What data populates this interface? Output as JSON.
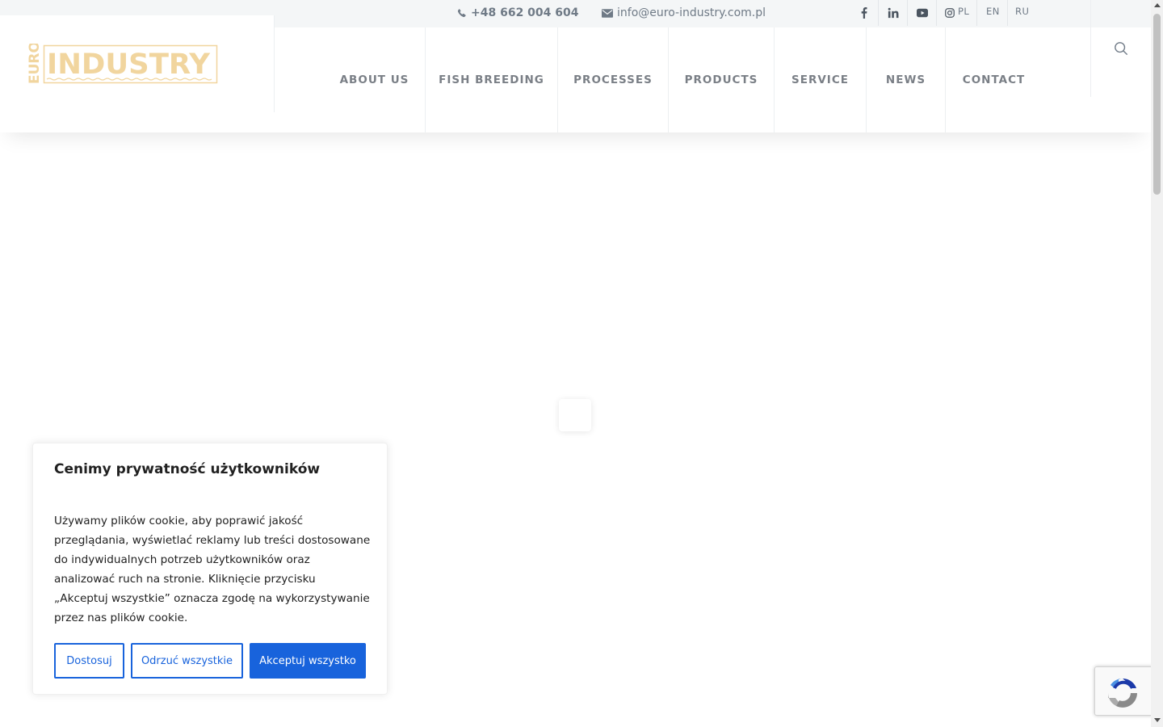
{
  "topbar": {
    "phone": "+48 662 004 604",
    "email": "info@euro-industry.com.pl",
    "social": [
      "facebook-icon",
      "linkedin-icon",
      "youtube-icon",
      "instagram-icon"
    ],
    "languages": [
      "PL",
      "EN",
      "RU"
    ]
  },
  "logo": {
    "euro": "EURO",
    "industry": "INDUSTRY",
    "color": "#f1d59e"
  },
  "nav": {
    "items": [
      "ABOUT US",
      "FISH BREEDING",
      "PROCESSES",
      "PRODUCTS",
      "SERVICE",
      "NEWS",
      "CONTACT"
    ]
  },
  "cookie": {
    "title": "Cenimy prywatność użytkowników",
    "body": "Używamy plików cookie, aby poprawić jakość przeglądania, wyświetlać reklamy lub treści dostosowane do indywidualnych potrzeb użytkowników oraz analizować ruch na stronie. Kliknięcie przycisku „Akceptuj wszystkie” oznacza zgodę na wykorzystywanie przez nas plików cookie.",
    "customize_label": "Dostosuj",
    "reject_label": "Odrzuć wszystkie",
    "accept_label": "Akceptuj wszystko",
    "accent": "#1863dc"
  }
}
